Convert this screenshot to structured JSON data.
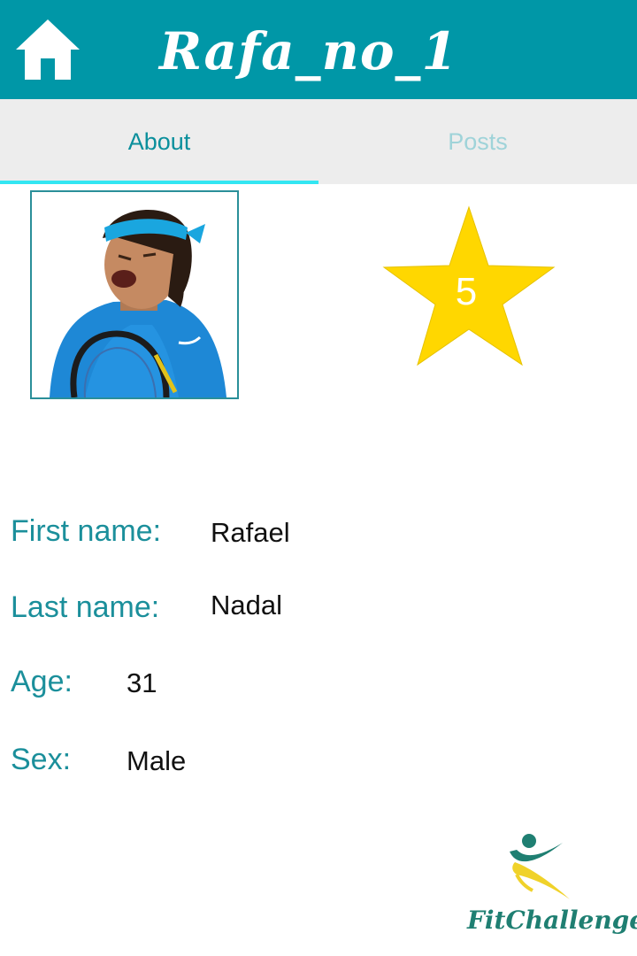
{
  "header": {
    "title": "Rafa_no_1",
    "home_icon": "home-icon",
    "background_color": "#0097a7"
  },
  "tabs": [
    {
      "label": "About",
      "active": true
    },
    {
      "label": "Posts",
      "active": false
    }
  ],
  "profile": {
    "avatar": "profile-photo",
    "rating": "5",
    "rating_icon": "star-icon",
    "rating_color": "#ffd700"
  },
  "fields": [
    {
      "label": "First name:",
      "value": "Rafael"
    },
    {
      "label": "Last name:",
      "value": "Nadal"
    },
    {
      "label": "Age:",
      "value": "31"
    },
    {
      "label": "Sex:",
      "value": "Male"
    }
  ],
  "brand": {
    "name": "FitChallenger",
    "logo_icon": "fitchallenger-logo-icon"
  },
  "colors": {
    "accent": "#0097a7",
    "tab_indicator": "#33e6f2",
    "label_text": "#1b8f9b",
    "tab_bar": "#ededed"
  }
}
